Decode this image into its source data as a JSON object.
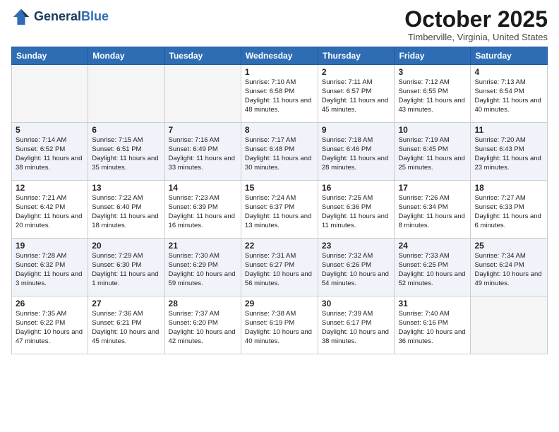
{
  "header": {
    "logo_general": "General",
    "logo_blue": "Blue",
    "month_title": "October 2025",
    "location": "Timberville, Virginia, United States"
  },
  "weekdays": [
    "Sunday",
    "Monday",
    "Tuesday",
    "Wednesday",
    "Thursday",
    "Friday",
    "Saturday"
  ],
  "weeks": [
    [
      {
        "day": "",
        "info": ""
      },
      {
        "day": "",
        "info": ""
      },
      {
        "day": "",
        "info": ""
      },
      {
        "day": "1",
        "info": "Sunrise: 7:10 AM\nSunset: 6:58 PM\nDaylight: 11 hours\nand 48 minutes."
      },
      {
        "day": "2",
        "info": "Sunrise: 7:11 AM\nSunset: 6:57 PM\nDaylight: 11 hours\nand 45 minutes."
      },
      {
        "day": "3",
        "info": "Sunrise: 7:12 AM\nSunset: 6:55 PM\nDaylight: 11 hours\nand 43 minutes."
      },
      {
        "day": "4",
        "info": "Sunrise: 7:13 AM\nSunset: 6:54 PM\nDaylight: 11 hours\nand 40 minutes."
      }
    ],
    [
      {
        "day": "5",
        "info": "Sunrise: 7:14 AM\nSunset: 6:52 PM\nDaylight: 11 hours\nand 38 minutes."
      },
      {
        "day": "6",
        "info": "Sunrise: 7:15 AM\nSunset: 6:51 PM\nDaylight: 11 hours\nand 35 minutes."
      },
      {
        "day": "7",
        "info": "Sunrise: 7:16 AM\nSunset: 6:49 PM\nDaylight: 11 hours\nand 33 minutes."
      },
      {
        "day": "8",
        "info": "Sunrise: 7:17 AM\nSunset: 6:48 PM\nDaylight: 11 hours\nand 30 minutes."
      },
      {
        "day": "9",
        "info": "Sunrise: 7:18 AM\nSunset: 6:46 PM\nDaylight: 11 hours\nand 28 minutes."
      },
      {
        "day": "10",
        "info": "Sunrise: 7:19 AM\nSunset: 6:45 PM\nDaylight: 11 hours\nand 25 minutes."
      },
      {
        "day": "11",
        "info": "Sunrise: 7:20 AM\nSunset: 6:43 PM\nDaylight: 11 hours\nand 23 minutes."
      }
    ],
    [
      {
        "day": "12",
        "info": "Sunrise: 7:21 AM\nSunset: 6:42 PM\nDaylight: 11 hours\nand 20 minutes."
      },
      {
        "day": "13",
        "info": "Sunrise: 7:22 AM\nSunset: 6:40 PM\nDaylight: 11 hours\nand 18 minutes."
      },
      {
        "day": "14",
        "info": "Sunrise: 7:23 AM\nSunset: 6:39 PM\nDaylight: 11 hours\nand 16 minutes."
      },
      {
        "day": "15",
        "info": "Sunrise: 7:24 AM\nSunset: 6:37 PM\nDaylight: 11 hours\nand 13 minutes."
      },
      {
        "day": "16",
        "info": "Sunrise: 7:25 AM\nSunset: 6:36 PM\nDaylight: 11 hours\nand 11 minutes."
      },
      {
        "day": "17",
        "info": "Sunrise: 7:26 AM\nSunset: 6:34 PM\nDaylight: 11 hours\nand 8 minutes."
      },
      {
        "day": "18",
        "info": "Sunrise: 7:27 AM\nSunset: 6:33 PM\nDaylight: 11 hours\nand 6 minutes."
      }
    ],
    [
      {
        "day": "19",
        "info": "Sunrise: 7:28 AM\nSunset: 6:32 PM\nDaylight: 11 hours\nand 3 minutes."
      },
      {
        "day": "20",
        "info": "Sunrise: 7:29 AM\nSunset: 6:30 PM\nDaylight: 11 hours\nand 1 minute."
      },
      {
        "day": "21",
        "info": "Sunrise: 7:30 AM\nSunset: 6:29 PM\nDaylight: 10 hours\nand 59 minutes."
      },
      {
        "day": "22",
        "info": "Sunrise: 7:31 AM\nSunset: 6:27 PM\nDaylight: 10 hours\nand 56 minutes."
      },
      {
        "day": "23",
        "info": "Sunrise: 7:32 AM\nSunset: 6:26 PM\nDaylight: 10 hours\nand 54 minutes."
      },
      {
        "day": "24",
        "info": "Sunrise: 7:33 AM\nSunset: 6:25 PM\nDaylight: 10 hours\nand 52 minutes."
      },
      {
        "day": "25",
        "info": "Sunrise: 7:34 AM\nSunset: 6:24 PM\nDaylight: 10 hours\nand 49 minutes."
      }
    ],
    [
      {
        "day": "26",
        "info": "Sunrise: 7:35 AM\nSunset: 6:22 PM\nDaylight: 10 hours\nand 47 minutes."
      },
      {
        "day": "27",
        "info": "Sunrise: 7:36 AM\nSunset: 6:21 PM\nDaylight: 10 hours\nand 45 minutes."
      },
      {
        "day": "28",
        "info": "Sunrise: 7:37 AM\nSunset: 6:20 PM\nDaylight: 10 hours\nand 42 minutes."
      },
      {
        "day": "29",
        "info": "Sunrise: 7:38 AM\nSunset: 6:19 PM\nDaylight: 10 hours\nand 40 minutes."
      },
      {
        "day": "30",
        "info": "Sunrise: 7:39 AM\nSunset: 6:17 PM\nDaylight: 10 hours\nand 38 minutes."
      },
      {
        "day": "31",
        "info": "Sunrise: 7:40 AM\nSunset: 6:16 PM\nDaylight: 10 hours\nand 36 minutes."
      },
      {
        "day": "",
        "info": ""
      }
    ]
  ]
}
